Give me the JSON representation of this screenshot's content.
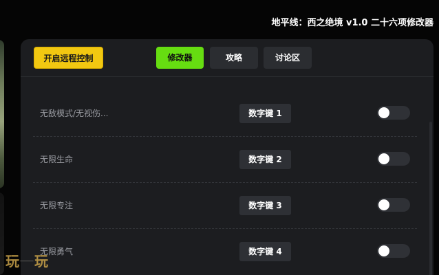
{
  "app": {
    "title": "地平线：西之绝境 v1.0 二十六项修改器"
  },
  "toolbar": {
    "remote_label": "开启远程控制",
    "tabs": [
      {
        "label": "修改器",
        "active": true
      },
      {
        "label": "攻略",
        "active": false
      },
      {
        "label": "讨论区",
        "active": false
      }
    ]
  },
  "cheats": [
    {
      "label": "无敌模式/无视伤...",
      "hotkey": "数字键 1",
      "enabled": false
    },
    {
      "label": "无限生命",
      "hotkey": "数字键 2",
      "enabled": false
    },
    {
      "label": "无限专注",
      "hotkey": "数字键 3",
      "enabled": false
    },
    {
      "label": "无限勇气",
      "hotkey": "数字键 4",
      "enabled": false
    }
  ],
  "watermark": {
    "left": "玩",
    "dash": "一",
    "right": "玩"
  },
  "colors": {
    "accent_green": "#66dd11",
    "remote_yellow": "#f2c811",
    "panel_bg": "#1c1d20"
  }
}
